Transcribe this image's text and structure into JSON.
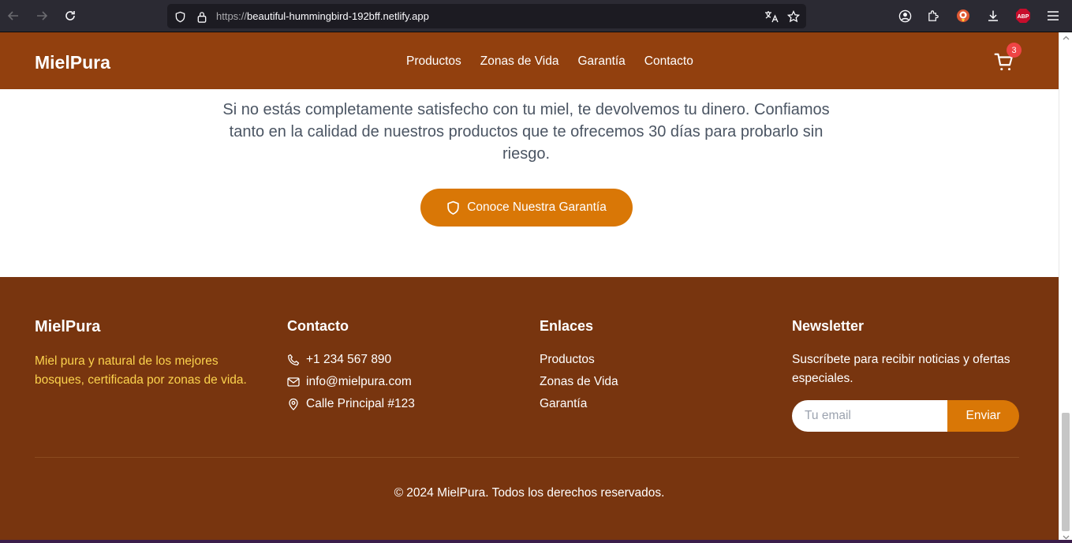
{
  "browser": {
    "url_prefix": "https://",
    "url_host": "beautiful-hummingbird-192bff.netlify.app",
    "extension_label": "ABP"
  },
  "header": {
    "brand": "MielPura",
    "nav": [
      "Productos",
      "Zonas de Vida",
      "Garantía",
      "Contacto"
    ],
    "cart_count": "3"
  },
  "guarantee": {
    "text": "Si no estás completamente satisfecho con tu miel, te devolvemos tu dinero. Confiamos tanto en la calidad de nuestros productos que te ofrecemos 30 días para probarlo sin riesgo.",
    "button_label": "Conoce Nuestra Garantía"
  },
  "footer": {
    "brand": "MielPura",
    "description": "Miel pura y natural de los mejores bosques, certificada por zonas de vida.",
    "contact": {
      "title": "Contacto",
      "phone": "+1 234 567 890",
      "email": "info@mielpura.com",
      "address": "Calle Principal #123"
    },
    "links": {
      "title": "Enlaces",
      "items": [
        "Productos",
        "Zonas de Vida",
        "Garantía"
      ]
    },
    "newsletter": {
      "title": "Newsletter",
      "description": "Suscríbete para recibir noticias y ofertas especiales.",
      "placeholder": "Tu email",
      "button_label": "Enviar"
    },
    "copyright": "© 2024 MielPura. Todos los derechos reservados."
  },
  "colors": {
    "header_bg": "#92400e",
    "footer_bg": "#78350f",
    "accent": "#d97706",
    "footer_desc": "#fcd34d",
    "badge": "#ef4444"
  },
  "icons": {
    "back": "arrow-left-icon",
    "forward": "arrow-right-icon",
    "reload": "reload-icon",
    "shield": "shield-icon",
    "lock": "lock-icon",
    "translate": "translate-icon",
    "bookmark": "star-icon",
    "account": "account-icon",
    "extensions": "puzzle-icon",
    "downloads": "download-icon",
    "menu": "hamburger-menu-icon",
    "cart": "cart-icon",
    "phone": "phone-icon",
    "mail": "mail-icon",
    "location": "map-pin-icon"
  }
}
